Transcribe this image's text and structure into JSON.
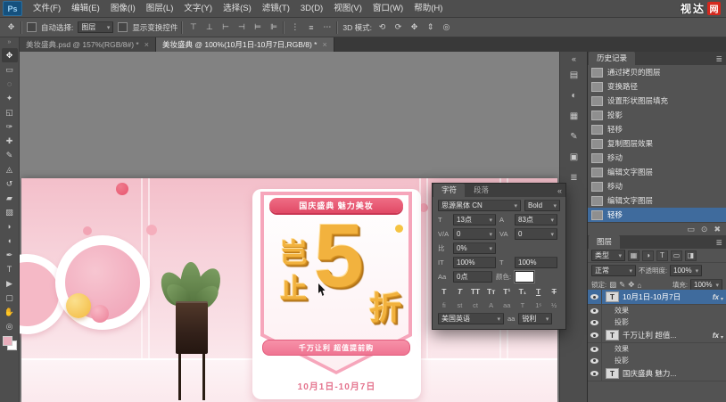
{
  "app": {
    "logo": "Ps",
    "watermark": {
      "text": "视达",
      "badge": "网"
    }
  },
  "menubar": {
    "items": [
      "文件(F)",
      "编辑(E)",
      "图像(I)",
      "图层(L)",
      "文字(Y)",
      "选择(S)",
      "滤镜(T)",
      "3D(D)",
      "视图(V)",
      "窗口(W)",
      "帮助(H)"
    ]
  },
  "options": {
    "auto_select_label": "自动选择:",
    "auto_select_value": "图层",
    "show_transform_label": "显示变换控件",
    "mode_label": "3D 模式:",
    "align_icons": [
      {
        "name": "align-top",
        "glyph": "⊤"
      },
      {
        "name": "align-middle",
        "glyph": "⊥"
      },
      {
        "name": "align-left",
        "glyph": "⊢"
      },
      {
        "name": "align-right",
        "glyph": "⊣"
      },
      {
        "name": "align-center",
        "glyph": "⊨"
      },
      {
        "name": "align-bottom",
        "glyph": "⊫"
      }
    ],
    "distribute_icons": [
      {
        "name": "distribute-vertical",
        "glyph": "⋮"
      },
      {
        "name": "distribute-center",
        "glyph": "≡"
      },
      {
        "name": "distribute-horizontal",
        "glyph": "⋯"
      }
    ],
    "mode_icons": [
      {
        "name": "rotate-3d",
        "glyph": "⟲"
      },
      {
        "name": "roll-3d",
        "glyph": "⟳"
      },
      {
        "name": "drag-3d",
        "glyph": "✥"
      },
      {
        "name": "slide-3d",
        "glyph": "⇕"
      },
      {
        "name": "scale-3d",
        "glyph": "◎"
      }
    ]
  },
  "tabs": {
    "documents": [
      {
        "label": "美妆盛典.psd @ 157%(RGB/8#) *"
      },
      {
        "label": "美妆盛典 @ 100%(10月1日-10月7日,RGB/8) *"
      }
    ],
    "close": "×"
  },
  "tools": [
    {
      "name": "move",
      "glyph": "✥"
    },
    {
      "name": "marquee",
      "glyph": "▭"
    },
    {
      "name": "lasso",
      "glyph": "◌"
    },
    {
      "name": "quick-select",
      "glyph": "✦"
    },
    {
      "name": "crop",
      "glyph": "◱"
    },
    {
      "name": "eyedropper",
      "glyph": "✑"
    },
    {
      "name": "healing-brush",
      "glyph": "✚"
    },
    {
      "name": "brush",
      "glyph": "✎"
    },
    {
      "name": "clone-stamp",
      "glyph": "◬"
    },
    {
      "name": "history-brush",
      "glyph": "↺"
    },
    {
      "name": "eraser",
      "glyph": "▰"
    },
    {
      "name": "gradient",
      "glyph": "▨"
    },
    {
      "name": "blur",
      "glyph": "◗"
    },
    {
      "name": "dodge",
      "glyph": "◖"
    },
    {
      "name": "pen",
      "glyph": "✒"
    },
    {
      "name": "type",
      "glyph": "T"
    },
    {
      "name": "path-select",
      "glyph": "▶"
    },
    {
      "name": "shape",
      "glyph": "▢"
    },
    {
      "name": "hand",
      "glyph": "✋"
    },
    {
      "name": "zoom",
      "glyph": "◎"
    }
  ],
  "artwork": {
    "ribbon_top": "国庆盛典 魅力美妆",
    "word_top": "岂",
    "word_bottom": "止",
    "big_number": "5",
    "word_right": "折",
    "ribbon_sub": "千万让利 超值提前购",
    "date": "10月1日-10月7日"
  },
  "char_panel": {
    "tab_character": "字符",
    "tab_paragraph": "段落",
    "collapse_icon": "«",
    "font_family": "思源黑体 CN",
    "font_style": "Bold",
    "size_label": "T",
    "size": "13点",
    "leading_label": "A",
    "leading": "83点",
    "kerning_label": "V/A",
    "kerning": "0",
    "tracking_label": "VA",
    "tracking": "0",
    "proportional_label": "比",
    "proportional": "0%",
    "vertical_scale_label": "IT",
    "vertical_scale": "100%",
    "horizontal_scale_label": "T",
    "horizontal_scale": "100%",
    "baseline_label": "Aa",
    "baseline": "0点",
    "color_label": "颜色:",
    "style_buttons": [
      {
        "name": "faux-bold",
        "glyph": "T"
      },
      {
        "name": "faux-italic",
        "glyph": "T"
      },
      {
        "name": "all-caps",
        "glyph": "TT"
      },
      {
        "name": "small-caps",
        "glyph": "Tᴛ"
      },
      {
        "name": "superscript",
        "glyph": "T¹"
      },
      {
        "name": "subscript",
        "glyph": "T₁"
      },
      {
        "name": "underline",
        "glyph": "T"
      },
      {
        "name": "strikethrough",
        "glyph": "T"
      }
    ],
    "opentype_buttons": [
      {
        "name": "standard-ligatures",
        "glyph": "ﬁ"
      },
      {
        "name": "contextual-alternates",
        "glyph": "st"
      },
      {
        "name": "discretionary-ligatures",
        "glyph": "ct"
      },
      {
        "name": "swash",
        "glyph": "A"
      },
      {
        "name": "stylistic-alternates",
        "glyph": "aa"
      },
      {
        "name": "titling-alternates",
        "glyph": "T"
      },
      {
        "name": "ordinals",
        "glyph": "1ˢ"
      },
      {
        "name": "fractions",
        "glyph": "½"
      }
    ],
    "language": "美国英语",
    "antialias_label": "aa",
    "antialias": "锐利"
  },
  "history": {
    "title": "历史记录",
    "items": [
      "通过拷贝的图层",
      "变换路径",
      "设置形状图层填充",
      "投影",
      "轻移",
      "复制图层效果",
      "移动",
      "编辑文字图层",
      "移动",
      "编辑文字图层",
      "轻移"
    ],
    "bottom_icons": [
      {
        "name": "new-doc-from-state",
        "glyph": "▭"
      },
      {
        "name": "new-snapshot",
        "glyph": "⊙"
      },
      {
        "name": "delete-state",
        "glyph": "✖"
      }
    ]
  },
  "layers": {
    "tab": "图层",
    "filter_label": "类型",
    "filter_icons": [
      {
        "name": "filter-pixel",
        "glyph": "▦"
      },
      {
        "name": "filter-adjustment",
        "glyph": "◑"
      },
      {
        "name": "filter-type",
        "glyph": "T"
      },
      {
        "name": "filter-shape",
        "glyph": "▭"
      },
      {
        "name": "filter-smart",
        "glyph": "◨"
      }
    ],
    "blend_mode": "正常",
    "opacity_label": "不透明度:",
    "opacity": "100%",
    "lock_label": "锁定:",
    "lock_icons": [
      {
        "name": "lock-transparency",
        "glyph": "▨"
      },
      {
        "name": "lock-pixels",
        "glyph": "✎"
      },
      {
        "name": "lock-position",
        "glyph": "✥"
      },
      {
        "name": "lock-all",
        "glyph": "⌂"
      }
    ],
    "fill_label": "填充:",
    "fill": "100%",
    "thumb_glyph": "T",
    "rows": [
      {
        "name": "10月1日-10月7日",
        "fx": "fx"
      },
      {
        "name": "效果"
      },
      {
        "name": "投影"
      },
      {
        "name": "千万让利 超值...",
        "fx": "fx"
      },
      {
        "name": "效果"
      },
      {
        "name": "投影"
      },
      {
        "name": "国庆盛典 魅力..."
      }
    ]
  },
  "dock_icons": [
    {
      "name": "collapse-panels",
      "glyph": "«"
    },
    {
      "name": "swatches-panel",
      "glyph": "▤"
    },
    {
      "name": "adjustments-panel",
      "glyph": "◐"
    },
    {
      "name": "styles-panel",
      "glyph": "▦"
    },
    {
      "name": "brush-panel",
      "glyph": "✎"
    },
    {
      "name": "clone-source-panel",
      "glyph": "▣"
    },
    {
      "name": "info-panel",
      "glyph": "≣"
    }
  ]
}
